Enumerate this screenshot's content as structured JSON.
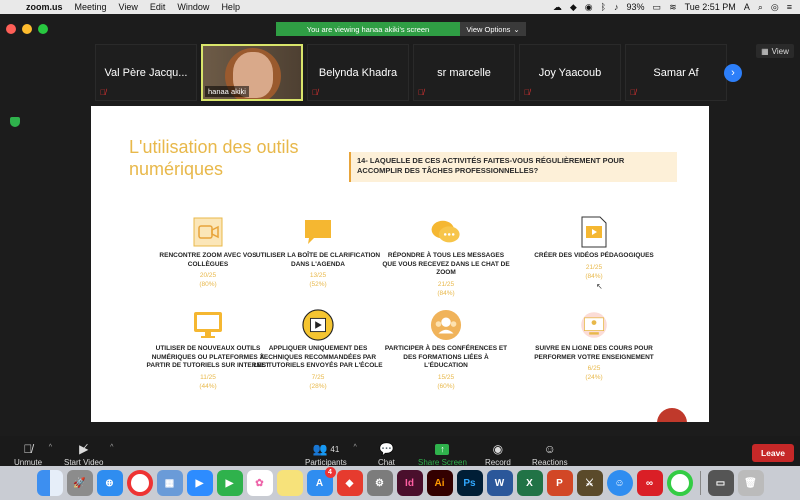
{
  "menubar": {
    "app_name": "zoom.us",
    "menus": [
      "Meeting",
      "View",
      "Edit",
      "Window",
      "Help"
    ],
    "battery": "93%",
    "clock": "Tue 2:51 PM",
    "input_source": "A"
  },
  "banner": {
    "message": "You are viewing hanaa akiki's screen",
    "options_label": "View Options"
  },
  "participants_strip": {
    "tiles": [
      {
        "name": "Val Père Jacqu..."
      },
      {
        "name": "hanaa akiki"
      },
      {
        "name": "Belynda Khadra"
      },
      {
        "name": "sr marcelle"
      },
      {
        "name": "Joy Yaacoub"
      },
      {
        "name": "Samar Af"
      }
    ],
    "view_label": "View"
  },
  "slide": {
    "title": "L'utilisation des outils numériques",
    "question": "14- Laquelle de ces activités faites-vous régulièrement pour accomplir des tâches professionnelles?",
    "items": [
      {
        "label": "Rencontre ZOOM avec vos collègues",
        "count": "20/25",
        "percent": "(80%)",
        "icon": "video-camera-icon"
      },
      {
        "label": "Utiliser la boîte de clarification dans l'agenda",
        "count": "13/25",
        "percent": "(52%)",
        "icon": "speech-bubble-icon"
      },
      {
        "label": "Répondre à tous les messages que vous recevez dans le chat de ZOOM",
        "count": "21/25",
        "percent": "(84%)",
        "icon": "chat-bubbles-icon"
      },
      {
        "label": "Créer des vidéos pédagogiques",
        "count": "21/25",
        "percent": "(84%)",
        "icon": "video-file-icon"
      },
      {
        "label": "Utiliser de nouveaux outils numériques ou plateformes à partir de tutoriels sur internet",
        "count": "11/25",
        "percent": "(44%)",
        "icon": "monitor-icon"
      },
      {
        "label": "Appliquer uniquement des techniques recommandées par les tutoriels envoyés par l'école",
        "count": "7/25",
        "percent": "(28%)",
        "icon": "film-reel-icon"
      },
      {
        "label": "Participer à des conférences et des formations liées à l'éducation",
        "count": "15/25",
        "percent": "(60%)",
        "icon": "conference-icon"
      },
      {
        "label": "Suivre en ligne des cours pour performer votre enseignement",
        "count": "6/25",
        "percent": "(24%)",
        "icon": "online-course-icon"
      }
    ]
  },
  "toolbar": {
    "unmute": "Unmute",
    "start_video": "Start Video",
    "participants": "Participants",
    "participants_count": "41",
    "chat": "Chat",
    "share_screen": "Share Screen",
    "record": "Record",
    "reactions": "Reactions",
    "leave": "Leave"
  },
  "dock": {
    "apps": [
      "finder-icon",
      "launchpad-icon",
      "safari-icon",
      "chrome-icon",
      "preview-icon",
      "zoom-icon",
      "facetime-icon",
      "photos-icon",
      "notes-icon",
      "app-store-icon",
      "anydesk-icon",
      "system-preferences-icon",
      "indesign-icon",
      "illustrator-icon",
      "photoshop-icon",
      "word-icon",
      "excel-icon",
      "powerpoint-icon",
      "game-icon",
      "accessibility-icon",
      "creative-cloud-icon",
      "chrome-alt-icon",
      "screenshot-icon",
      "trash-icon"
    ],
    "app_store_badge": "4"
  }
}
